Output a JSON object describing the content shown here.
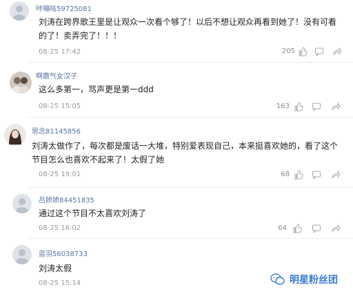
{
  "comments": [
    {
      "username": "咔嘣咕59725081",
      "text": "刘涛在跨界歌王里是让观众一次看个够了！以后不想让观众再看到她了！没有可看的了！卖弄完了！！！",
      "time": "08-25 17:42",
      "likes": "205"
    },
    {
      "username": "啊蘑气女汉子",
      "text": "这么多第一，骂声更是第一ddd",
      "time": "08-25 15:05",
      "likes": "163"
    },
    {
      "username": "思念81145856",
      "text": "刘涛太做作了，每次都是废话一大堆，特别爱表现自己，本来挺喜欢她的，看了这个节目怎么也喜欢不起来了！太假了她",
      "time": "08-25 19:01",
      "likes": "68"
    },
    {
      "username": "吕娇娇84451835",
      "text": "通过这个节目不太喜欢刘涛了",
      "time": "08-25 16:02",
      "likes": "64"
    },
    {
      "username": "蓝羽56038733",
      "text": "刘涛太假",
      "time": "08-25 15:14",
      "likes": ""
    }
  ],
  "watermark": {
    "text": "明星粉丝团"
  }
}
